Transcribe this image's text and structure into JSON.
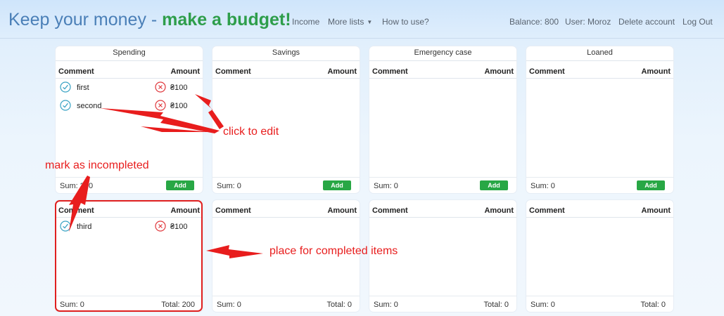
{
  "header": {
    "brand_part1": "Keep your money - ",
    "brand_part2": "make a budget!",
    "nav": {
      "income": "Income",
      "more_lists": "More lists",
      "how_to_use": "How to use?"
    },
    "balance": "Balance: 800",
    "user": "User: Moroz",
    "delete_account": "Delete account",
    "logout": "Log Out"
  },
  "columns": {
    "comment": "Comment",
    "amount": "Amount"
  },
  "lists": [
    {
      "title": "Spending",
      "active_items": [
        {
          "label": "first",
          "amount": "₴100"
        },
        {
          "label": "second",
          "amount": "₴100"
        }
      ],
      "active_sum": "Sum: 200",
      "add_label": "Add",
      "completed_items": [
        {
          "label": "third",
          "amount": "₴100"
        }
      ],
      "completed_sum": "Sum: 0",
      "total": "Total: 200"
    },
    {
      "title": "Savings",
      "active_items": [],
      "active_sum": "Sum: 0",
      "add_label": "Add",
      "completed_items": [],
      "completed_sum": "Sum: 0",
      "total": "Total: 0"
    },
    {
      "title": "Emergency case",
      "active_items": [],
      "active_sum": "Sum: 0",
      "add_label": "Add",
      "completed_items": [],
      "completed_sum": "Sum: 0",
      "total": "Total: 0"
    },
    {
      "title": "Loaned",
      "active_items": [],
      "active_sum": "Sum: 0",
      "add_label": "Add",
      "completed_items": [],
      "completed_sum": "Sum: 0",
      "total": "Total: 0"
    }
  ],
  "annotations": {
    "click_to_edit": "click to edit",
    "mark_as_incompleted": "mark as incompleted",
    "place_for_completed": "place for completed items"
  },
  "icons": {
    "check": "check-circle-icon",
    "delete": "close-circle-icon",
    "caret": "caret-down-icon"
  },
  "colors": {
    "brand_blue": "#4a7fb7",
    "brand_green": "#2e9e4b",
    "add_button": "#28a745",
    "check_teal": "#3aa3c4",
    "delete_red": "#e0393e",
    "annotation_red": "#e81d1d"
  }
}
